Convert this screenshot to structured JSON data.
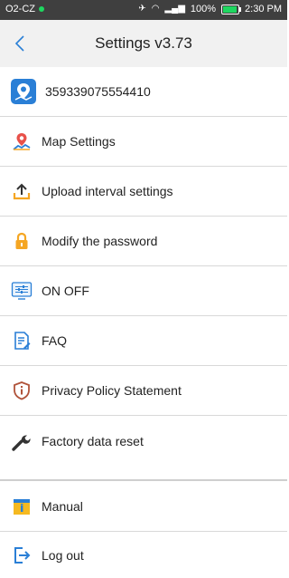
{
  "status_bar": {
    "carrier": "O2-CZ",
    "battery": "100%",
    "time": "2:30 PM"
  },
  "header": {
    "title": "Settings v3.73"
  },
  "menu": {
    "device_id": "359339075554410",
    "items": [
      {
        "label": "Map Settings",
        "icon": "map-pin-icon"
      },
      {
        "label": "Upload interval settings",
        "icon": "upload-icon"
      },
      {
        "label": "Modify the password",
        "icon": "lock-icon"
      },
      {
        "label": "ON OFF",
        "icon": "sliders-icon"
      },
      {
        "label": "FAQ",
        "icon": "document-icon"
      },
      {
        "label": "Privacy Policy Statement",
        "icon": "shield-icon"
      },
      {
        "label": "Factory data reset",
        "icon": "wrench-icon"
      },
      {
        "label": "Manual",
        "icon": "book-icon"
      },
      {
        "label": "Log out",
        "icon": "logout-icon"
      }
    ]
  },
  "colors": {
    "accent_blue": "#2a7fd6",
    "orange": "#f5a623",
    "status_bar": "#3f3f3f"
  }
}
